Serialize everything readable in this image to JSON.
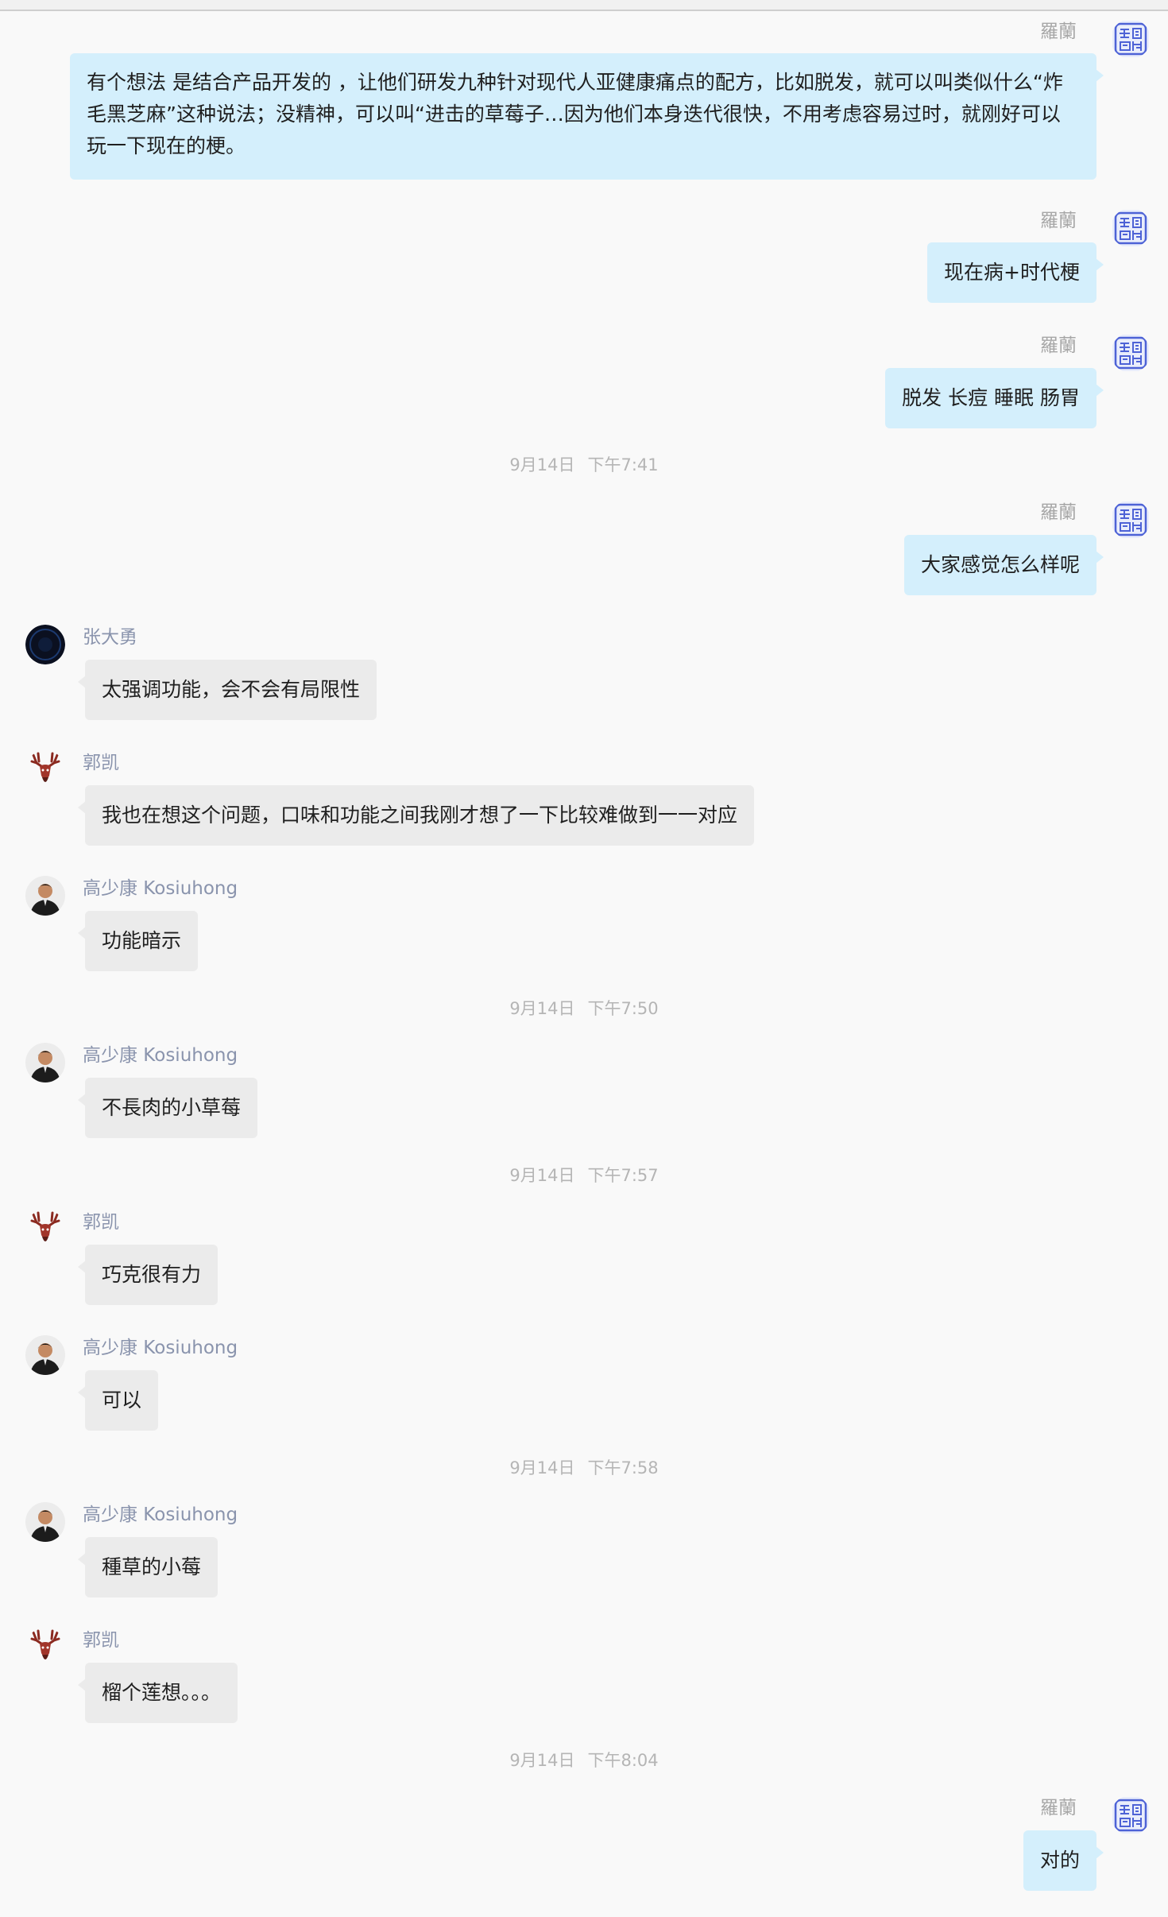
{
  "names": {
    "self": "羅蘭",
    "zhang": "张大勇",
    "guo": "郭凯",
    "gao": "高少康 Kosiuhong"
  },
  "messages": [
    {
      "text": "有个想法 是结合产品开发的 ，让他们研发九种针对现代人亚健康痛点的配方，比如脱发，就可以叫类似什么“炸毛黑芝麻”这种说法；没精神，可以叫“进击的草莓子…因为他们本身迭代很快，不用考虑容易过时，就刚好可以玩一下现在的梗。"
    },
    {
      "text": "现在病+时代梗"
    },
    {
      "text": "脱发 长痘 睡眠 肠胃"
    },
    {
      "text": "大家感觉怎么样呢"
    },
    {
      "text": "太强调功能，会不会有局限性"
    },
    {
      "text": "我也在想这个问题，口味和功能之间我刚才想了一下比较难做到一一对应"
    },
    {
      "text": "功能暗示"
    },
    {
      "text": "不長肉的小草莓"
    },
    {
      "text": "巧克很有力"
    },
    {
      "text": "可以"
    },
    {
      "text": "種草的小莓"
    },
    {
      "text": "榴个莲想。。。"
    },
    {
      "text": "对的"
    }
  ],
  "timestamps": [
    {
      "date": "9月14日",
      "time": "下午7:41"
    },
    {
      "date": "9月14日",
      "time": "下午7:50"
    },
    {
      "date": "9月14日",
      "time": "下午7:57"
    },
    {
      "date": "9月14日",
      "time": "下午7:58"
    },
    {
      "date": "9月14日",
      "time": "下午8:04"
    }
  ],
  "colors": {
    "self_bubble": "#d4effc",
    "other_bubble": "#ebebeb",
    "sender_name": "#8a94ad",
    "self_name": "#a7a7a7",
    "timestamp": "#b5b5b5"
  },
  "icons": {
    "self_avatar": "blue-seal-avatar-icon",
    "zhang_avatar": "dark-circle-avatar-icon",
    "guo_avatar": "deer-head-avatar-icon",
    "gao_avatar": "person-portrait-avatar-icon"
  }
}
